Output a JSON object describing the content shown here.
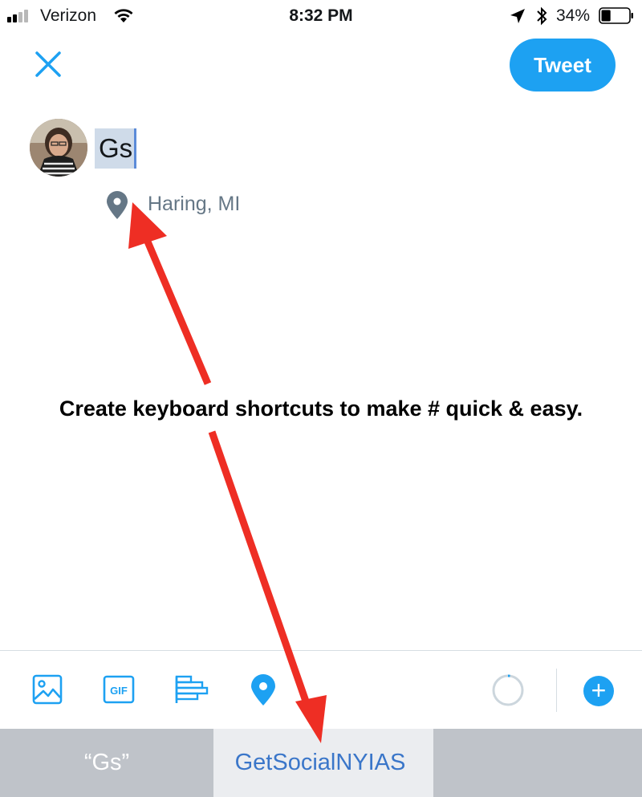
{
  "status_bar": {
    "carrier": "Verizon",
    "time": "8:32 PM",
    "battery_percent": "34%",
    "battery_level": 0.34,
    "signal_bars": 2,
    "icons": [
      "signal-icon",
      "wifi-icon",
      "location-arrow-icon",
      "bluetooth-icon",
      "battery-icon"
    ]
  },
  "header": {
    "close_icon": "close-icon",
    "tweet_label": "Tweet"
  },
  "compose": {
    "text": "Gs",
    "location": "Haring, MI"
  },
  "annotation": {
    "text": "Create keyboard shortcuts to make # quick & easy."
  },
  "toolbar": {
    "icons": [
      "image-icon",
      "gif-icon",
      "poll-icon",
      "location-pin-icon",
      "character-counter-icon",
      "add-tweet-icon"
    ],
    "gif_label": "GIF",
    "plus_label": "+"
  },
  "predictive_bar": {
    "suggestions": [
      "“Gs”",
      "GetSocialNYIAS",
      ""
    ]
  },
  "colors": {
    "accent": "#1da1f2",
    "arrow": "#ee2e24",
    "selection": "#cfdbe9"
  }
}
